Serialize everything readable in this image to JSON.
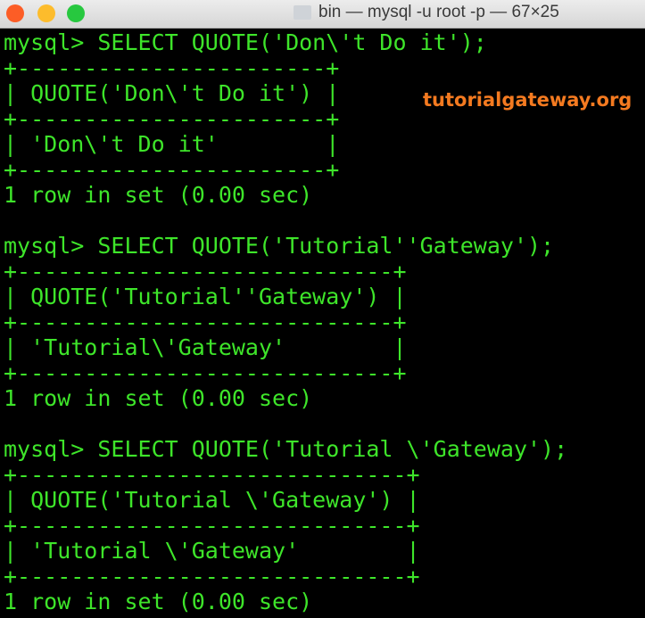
{
  "window": {
    "title": "bin — mysql -u root -p — 67×25"
  },
  "watermark": "tutorialgateway.org",
  "terminal": {
    "lines": [
      "mysql> SELECT QUOTE('Don\\'t Do it');",
      "+-----------------------+",
      "| QUOTE('Don\\'t Do it') |",
      "+-----------------------+",
      "| 'Don\\'t Do it'        |",
      "+-----------------------+",
      "1 row in set (0.00 sec)",
      "",
      "mysql> SELECT QUOTE('Tutorial''Gateway');",
      "+----------------------------+",
      "| QUOTE('Tutorial''Gateway') |",
      "+----------------------------+",
      "| 'Tutorial\\'Gateway'        |",
      "+----------------------------+",
      "1 row in set (0.00 sec)",
      "",
      "mysql> SELECT QUOTE('Tutorial \\'Gateway');",
      "+-----------------------------+",
      "| QUOTE('Tutorial \\'Gateway') |",
      "+-----------------------------+",
      "| 'Tutorial \\'Gateway'        |",
      "+-----------------------------+",
      "1 row in set (0.00 sec)"
    ]
  }
}
